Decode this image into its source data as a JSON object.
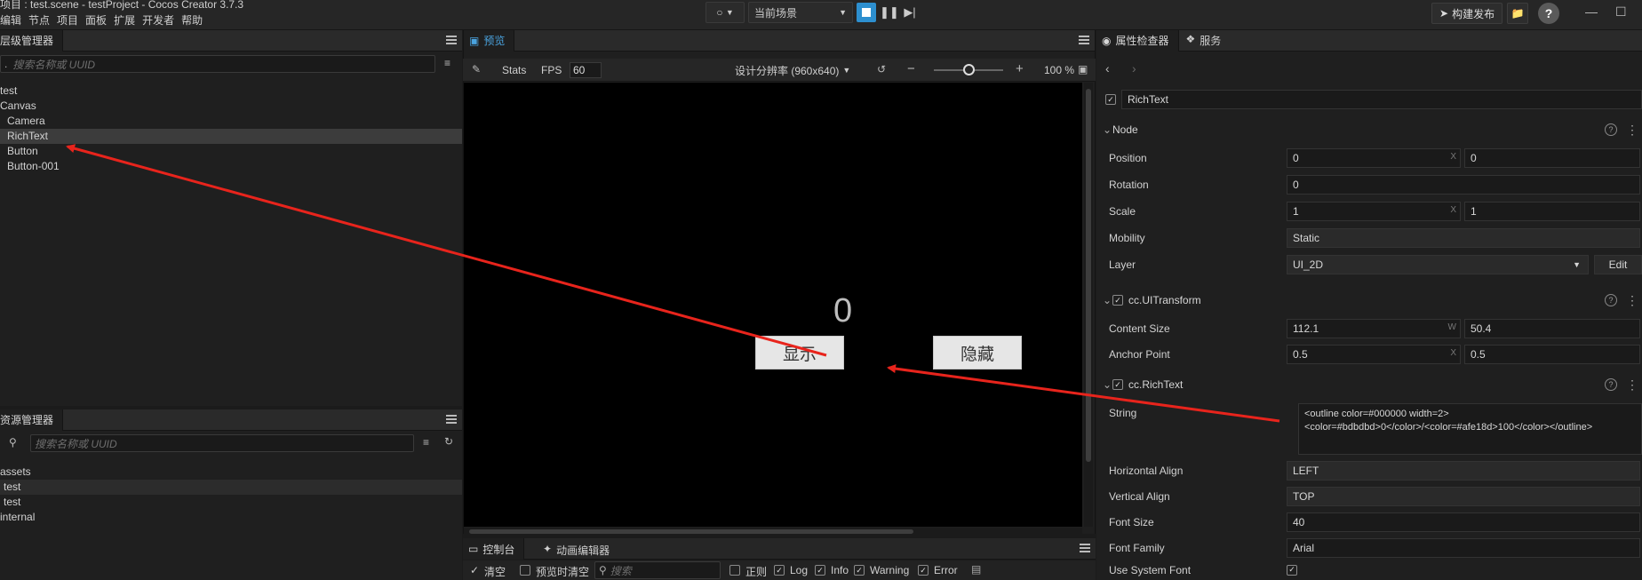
{
  "window": {
    "title": "项目 : test.scene - testProject - Cocos Creator 3.7.3",
    "menu": [
      "编辑",
      "节点",
      "项目",
      "面板",
      "扩展",
      "开发者",
      "帮助"
    ],
    "scene_select": "当前场景",
    "build_publish": "构建发布",
    "help": "?",
    "minimize": "—",
    "maximize": "☐"
  },
  "hierarchy": {
    "title": "层级管理器",
    "search_placeholder": "搜索名称或 UUID",
    "nodes": [
      "test",
      "Canvas",
      "Camera",
      "RichText",
      "Button",
      "Button-001"
    ]
  },
  "assets": {
    "title": "资源管理器",
    "search_placeholder": "搜索名称或 UUID",
    "items": [
      "assets",
      "test",
      "test",
      "internal"
    ]
  },
  "preview": {
    "tab": "预览",
    "stats": "Stats",
    "fps_label": "FPS",
    "fps_value": "60",
    "resolution": "设计分辨率 (960x640)",
    "zoom": "100 %",
    "game": {
      "label_text": "0",
      "show_button": "显示",
      "hide_button": "隐藏"
    }
  },
  "console": {
    "tab_console": "控制台",
    "tab_anim": "动画编辑器",
    "clear": "清空",
    "clear_on_preview": "预览时清空",
    "search_placeholder": "搜索",
    "regex": "正则",
    "log": "Log",
    "info": "Info",
    "warning": "Warning",
    "error": "Error"
  },
  "inspector": {
    "tab_inspector": "属性检查器",
    "tab_service": "服务",
    "node_name": "RichText",
    "node_section": "Node",
    "position": {
      "label": "Position",
      "x": "0",
      "y": "0"
    },
    "rotation": {
      "label": "Rotation",
      "value": "0"
    },
    "scale": {
      "label": "Scale",
      "x": "1",
      "y": "1"
    },
    "mobility": {
      "label": "Mobility",
      "value": "Static"
    },
    "layer": {
      "label": "Layer",
      "value": "UI_2D",
      "edit": "Edit"
    },
    "ui_transform": {
      "title": "cc.UITransform",
      "content_size": {
        "label": "Content Size",
        "w": "112.1",
        "h": "50.4"
      },
      "anchor_point": {
        "label": "Anchor Point",
        "x": "0.5",
        "y": "0.5"
      }
    },
    "rich_text": {
      "title": "cc.RichText",
      "string_label": "String",
      "string_line1": "<outline color=#000000 width=2>",
      "string_line2": "<color=#bdbdbd>0</color>/<color=#afe18d>100</color></outline>",
      "h_align": {
        "label": "Horizontal Align",
        "value": "LEFT"
      },
      "v_align": {
        "label": "Vertical Align",
        "value": "TOP"
      },
      "font_size": {
        "label": "Font Size",
        "value": "40"
      },
      "font_family": {
        "label": "Font Family",
        "value": "Arial"
      },
      "use_system_font": {
        "label": "Use System Font"
      }
    }
  },
  "colors": {
    "accent": "#2d8fcf",
    "arrow": "#e8241c",
    "panel_bg": "#1f1f1f"
  }
}
